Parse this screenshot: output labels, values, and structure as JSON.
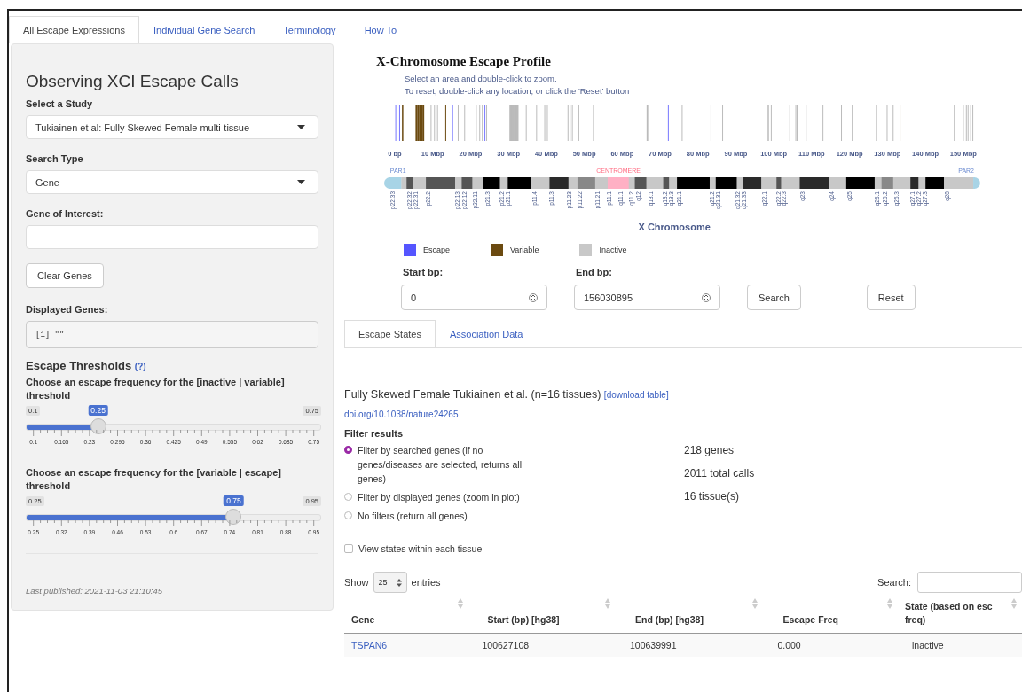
{
  "tabs": [
    {
      "label": "All Escape Expressions",
      "selected": true
    },
    {
      "label": "Individual Gene Search",
      "selected": false
    },
    {
      "label": "Terminology",
      "selected": false
    },
    {
      "label": "How To",
      "selected": false
    }
  ],
  "sidebar": {
    "title": "Observing XCI Escape Calls",
    "study": {
      "label": "Select a Study",
      "value": "Tukiainen et al: Fully Skewed Female multi-tissue"
    },
    "search_type": {
      "label": "Search Type",
      "value": "Gene"
    },
    "gene": {
      "label": "Gene of Interest:"
    },
    "clear_button": "Clear Genes",
    "displayed": {
      "label": "Displayed Genes:",
      "value": "[1] \"\""
    },
    "thresholds": {
      "title": "Escape Thresholds",
      "help": "(?)"
    },
    "sliders": [
      {
        "label": "Choose an escape frequency for the [inactive | variable] threshold",
        "min": "0.1",
        "max": "0.75",
        "value": "0.25",
        "level": 0.2308,
        "ticks": [
          "0.1",
          "0.165",
          "0.23",
          "0.295",
          "0.36",
          "0.425",
          "0.49",
          "0.555",
          "0.62",
          "0.685",
          "0.75"
        ]
      },
      {
        "label": "Choose an escape frequency for the [variable | escape] threshold",
        "min": "0.25",
        "max": "0.95",
        "value": "0.75",
        "level": 0.7143,
        "ticks": [
          "0.25",
          "0.32",
          "0.39",
          "0.46",
          "0.53",
          "0.6",
          "0.67",
          "0.74",
          "0.81",
          "0.88",
          "0.95"
        ]
      }
    ],
    "published": "Last published: 2021-11-03 21:10:45"
  },
  "plot": {
    "title": "X-Chromosome Escape Profile",
    "hints": [
      "Select an area and double-click to zoom.",
      "To reset, double-click any location, or click the 'Reset' button"
    ],
    "axis_labels": [
      "0 bp",
      "10 Mbp",
      "20 Mbp",
      "30 Mbp",
      "40 Mbp",
      "50 Mbp",
      "60 Mbp",
      "70 Mbp",
      "80 Mbp",
      "90 Mbp",
      "100 Mbp",
      "110 Mbp",
      "120 Mbp",
      "130 Mbp",
      "140 Mbp",
      "150 Mbp"
    ],
    "left_label": "PAR1",
    "center_label": "CENTROMERE",
    "right_label": "PAR2",
    "bands": [
      "p22.33",
      "p22.32",
      "p22.31",
      "p22.2",
      "p22.13",
      "p22.12",
      "p22.11",
      "p21.3",
      "p21.2",
      "p21.1",
      "p11.4",
      "p11.3",
      "p11.23",
      "p11.22",
      "p11.21",
      "p11.1",
      "q11.1",
      "q11.2",
      "q12",
      "q13.1",
      "q13.2",
      "q13.3",
      "q21.1",
      "q21.2",
      "q21.31",
      "q21.32",
      "q21.33",
      "q22.1",
      "q22.2",
      "q22.3",
      "q23",
      "q24",
      "q25",
      "q26.1",
      "q26.2",
      "q26.3",
      "q27.1",
      "q27.2",
      "q27.3",
      "q28"
    ],
    "chromosome_title": "X Chromosome",
    "legend": [
      {
        "label": "Escape",
        "color": "#5555ff"
      },
      {
        "label": "Variable",
        "color": "#6b4a10"
      },
      {
        "label": "Inactive",
        "color": "#c8c8c8"
      }
    ]
  },
  "range": {
    "start": {
      "label": "Start bp:",
      "value": "0"
    },
    "end": {
      "label": "End bp:",
      "value": "156030895"
    },
    "buttons": [
      "Search",
      "Reset"
    ]
  },
  "inner_tabs": [
    {
      "label": "Escape States",
      "selected": true
    },
    {
      "label": "Association Data",
      "selected": false
    }
  ],
  "results": {
    "heading": "Fully Skewed Female Tukiainen et al. (n=16 tissues)",
    "download": "[download table]",
    "doi": "doi.org/10.1038/nature24265",
    "filter_title": "Filter results",
    "filters": [
      {
        "label": "Filter by searched genes (if no genes/diseases are selected, returns all genes)",
        "selected": true
      },
      {
        "label": "Filter by displayed genes (zoom in plot)",
        "selected": false
      },
      {
        "label": "No filters (return all genes)",
        "selected": false
      }
    ],
    "stats": [
      "218 genes",
      "2011 total calls",
      "16 tissue(s)"
    ],
    "view_states": {
      "label": "View states within each tissue",
      "checked": false
    }
  },
  "table": {
    "show": "Show",
    "page_size": "25",
    "entries": "entries",
    "search_label": "Search:",
    "columns": [
      "Gene",
      "Start (bp) [hg38]",
      "End (bp) [hg38]",
      "Escape Freq",
      "State (based on esc freq)"
    ],
    "rows": [
      [
        "TSPAN6",
        "100627108",
        "100639991",
        "0.000",
        "inactive"
      ]
    ]
  }
}
